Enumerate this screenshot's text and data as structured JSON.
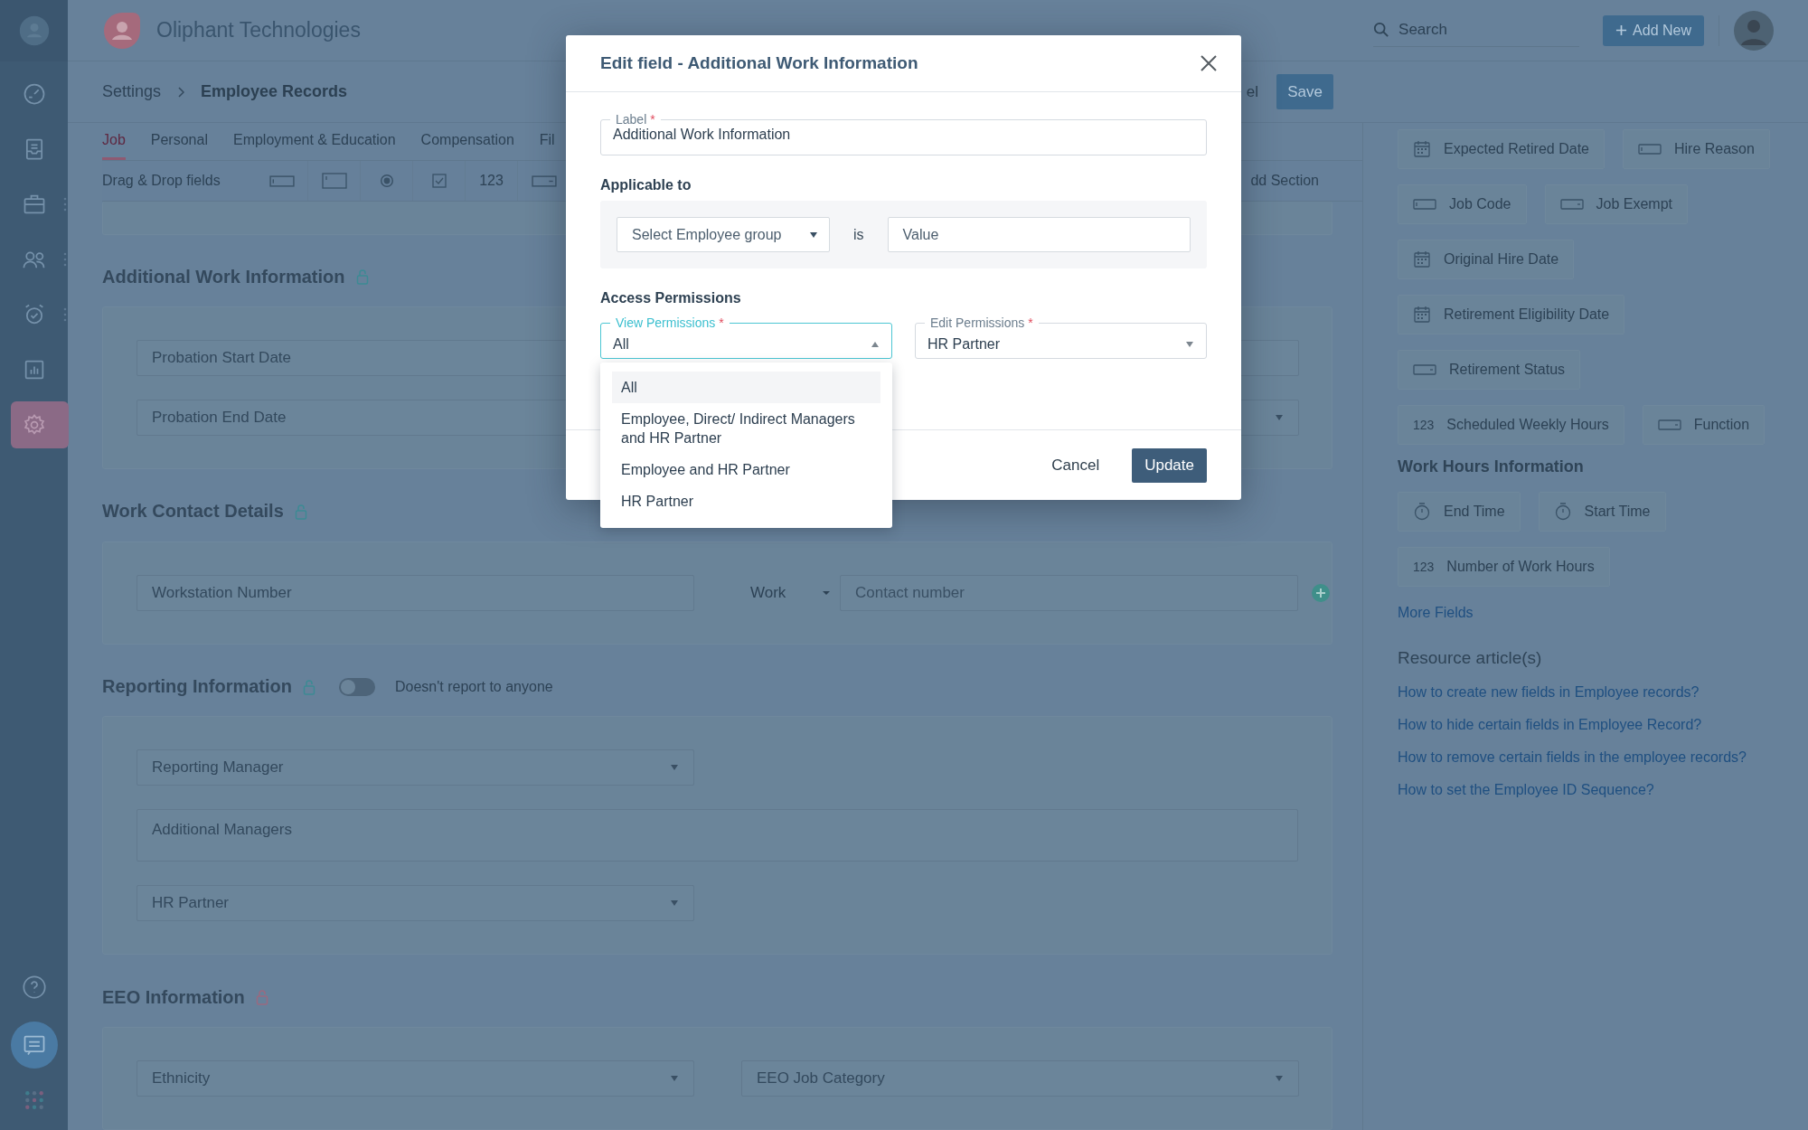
{
  "sidebar": {
    "items": [
      {
        "selected": false,
        "menu_dots": false
      },
      {
        "selected": false,
        "menu_dots": false
      },
      {
        "selected": false,
        "menu_dots": true
      },
      {
        "selected": false,
        "menu_dots": true
      },
      {
        "selected": false,
        "menu_dots": true
      },
      {
        "selected": false,
        "menu_dots": false
      },
      {
        "selected": true,
        "menu_dots": false
      }
    ]
  },
  "header": {
    "company": "Oliphant Technologies",
    "search": {
      "placeholder": "Search"
    },
    "add_button": "Add New"
  },
  "breadcrumb": [
    "Settings",
    "Employee Records"
  ],
  "page_actions": {
    "cancel": "el",
    "save": "Save"
  },
  "tabs": [
    {
      "label": "Job",
      "selected": true
    },
    {
      "label": "Personal",
      "selected": false
    },
    {
      "label": "Employment & Education",
      "selected": false
    },
    {
      "label": "Compensation",
      "selected": false
    },
    {
      "label": "Fil",
      "selected": false
    }
  ],
  "toolbar": {
    "label": "Drag & Drop fields",
    "tools": [
      {
        "kind": "text"
      },
      {
        "kind": "textarea"
      },
      {
        "kind": "radio"
      },
      {
        "kind": "checkbox"
      },
      {
        "kind": "number",
        "label": "123"
      },
      {
        "kind": "dropdown"
      }
    ],
    "add_section": "dd Section"
  },
  "sections": [
    {
      "title": "Additional Work Information",
      "lock": {
        "color": "#3d8a94"
      },
      "rows": [
        [
          {
            "kind": "input",
            "placeholder": "Probation Start Date"
          },
          {
            "kind": "input"
          }
        ],
        [
          {
            "kind": "input",
            "placeholder": "Probation End Date"
          },
          {
            "kind": "select"
          }
        ]
      ]
    },
    {
      "title": "Work Contact Details",
      "lock": {
        "color": "#3d8a94"
      },
      "rows": [
        [
          {
            "kind": "input",
            "placeholder": "Workstation Number"
          },
          {
            "kind": "phone",
            "type": "Work",
            "placeholder": "Contact number"
          }
        ]
      ]
    },
    {
      "title": "Reporting Information",
      "lock": {
        "color": "#3d8a94"
      },
      "toggle": {
        "on": false,
        "label": "Doesn't report to anyone"
      },
      "rows": [
        [
          {
            "kind": "select",
            "placeholder": "Reporting Manager"
          }
        ],
        [
          {
            "kind": "textarea",
            "placeholder": "Additional Managers"
          }
        ],
        [
          {
            "kind": "select",
            "placeholder": "HR Partner"
          }
        ]
      ]
    },
    {
      "title": "EEO Information",
      "lock": {
        "color": "#9a6a80"
      },
      "rows": [
        [
          {
            "kind": "select",
            "placeholder": "Ethnicity"
          },
          {
            "kind": "select",
            "placeholder": "EEO Job Category"
          }
        ]
      ]
    }
  ],
  "panel": {
    "fields": [
      [
        {
          "kind": "date",
          "label": "Expected Retired Date"
        },
        {
          "kind": "text",
          "label": "Hire Reason"
        }
      ],
      [
        {
          "kind": "text",
          "label": "Job Code"
        },
        {
          "kind": "dropdown",
          "label": "Job Exempt"
        }
      ],
      [
        {
          "kind": "date",
          "label": "Original Hire Date"
        }
      ],
      [
        {
          "kind": "date",
          "label": "Retirement Eligibility Date"
        }
      ],
      [
        {
          "kind": "dropdown",
          "label": "Retirement Status"
        }
      ],
      [
        {
          "kind": "number",
          "icon_text": "123",
          "label": "Scheduled Weekly Hours"
        },
        {
          "kind": "dropdown",
          "label": "Function"
        }
      ]
    ],
    "work_hours": {
      "title": "Work Hours Information",
      "fields": [
        [
          {
            "kind": "time",
            "label": "End Time"
          },
          {
            "kind": "time",
            "label": "Start Time"
          }
        ],
        [
          {
            "kind": "number",
            "icon_text": "123",
            "label": "Number of Work Hours"
          }
        ]
      ]
    },
    "more_fields": "More Fields",
    "resources": {
      "title": "Resource article(s)",
      "links": [
        "How to create new fields in Employee records?",
        "How to hide certain fields in Employee Record?",
        "How to remove certain fields in the employee records?",
        "How to set the Employee ID Sequence?"
      ]
    }
  },
  "modal": {
    "title": "Edit field - Additional Work Information",
    "label_field": {
      "label": "Label",
      "required_mark": "*",
      "value": "Additional Work Information"
    },
    "applicable": {
      "title": "Applicable to",
      "group": {
        "placeholder": "Select Employee group"
      },
      "operator": "is",
      "value": {
        "placeholder": "Value"
      }
    },
    "access": {
      "title": "Access Permissions",
      "view": {
        "label": "View Permissions",
        "required_mark": "*",
        "value": "All",
        "open": true,
        "options": [
          {
            "label": "All",
            "selected": true
          },
          {
            "label": "Employee, Direct/ Indirect Managers and HR Partner",
            "selected": false
          },
          {
            "label": "Employee and HR Partner",
            "selected": false
          },
          {
            "label": "HR Partner",
            "selected": false
          }
        ]
      },
      "edit": {
        "label": "Edit Permissions",
        "required_mark": "*",
        "value": "HR Partner",
        "open": false
      }
    },
    "buttons": {
      "cancel": "Cancel",
      "update": "Update"
    }
  }
}
